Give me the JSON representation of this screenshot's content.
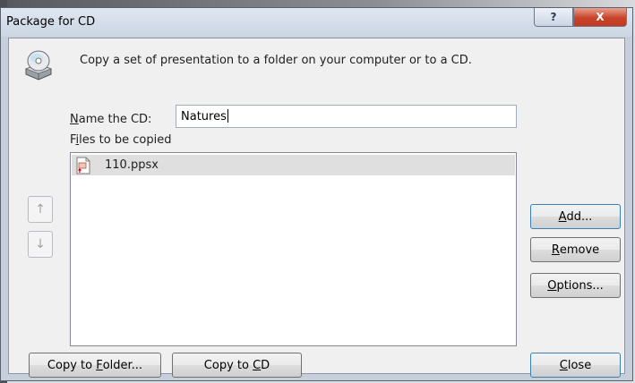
{
  "dialog": {
    "title": "Package for CD",
    "help_symbol": "?",
    "close_symbol": "X"
  },
  "instruction": "Copy a set of presentation to a folder on your computer or to a CD.",
  "name_field": {
    "label_accel": "N",
    "label_rest": "ame the CD:",
    "value": "Natures"
  },
  "files": {
    "label_pre": "F",
    "label_accel": "i",
    "label_rest": "les to be copied",
    "items": [
      {
        "name": "110.ppsx",
        "selected": true
      }
    ]
  },
  "arrows": {
    "up": "↑",
    "down": "↓"
  },
  "buttons": {
    "add_accel": "A",
    "add_rest": "dd...",
    "remove_accel": "R",
    "remove_rest": "emove",
    "options_accel": "O",
    "options_rest": "ptions...",
    "folder_pre": "Copy to ",
    "folder_accel": "F",
    "folder_rest": "older...",
    "cd_pre": "Copy to ",
    "cd_accel": "C",
    "cd_rest": "D",
    "close_accel": "C",
    "close_rest": "lose"
  },
  "colors": {
    "title_bar": "#cbd6e3",
    "close_button": "#c8432a",
    "selection": "#dfdfdf"
  },
  "icons": [
    "cd-drive-icon",
    "ppsx-file-icon",
    "arrow-up-icon",
    "arrow-down-icon"
  ]
}
